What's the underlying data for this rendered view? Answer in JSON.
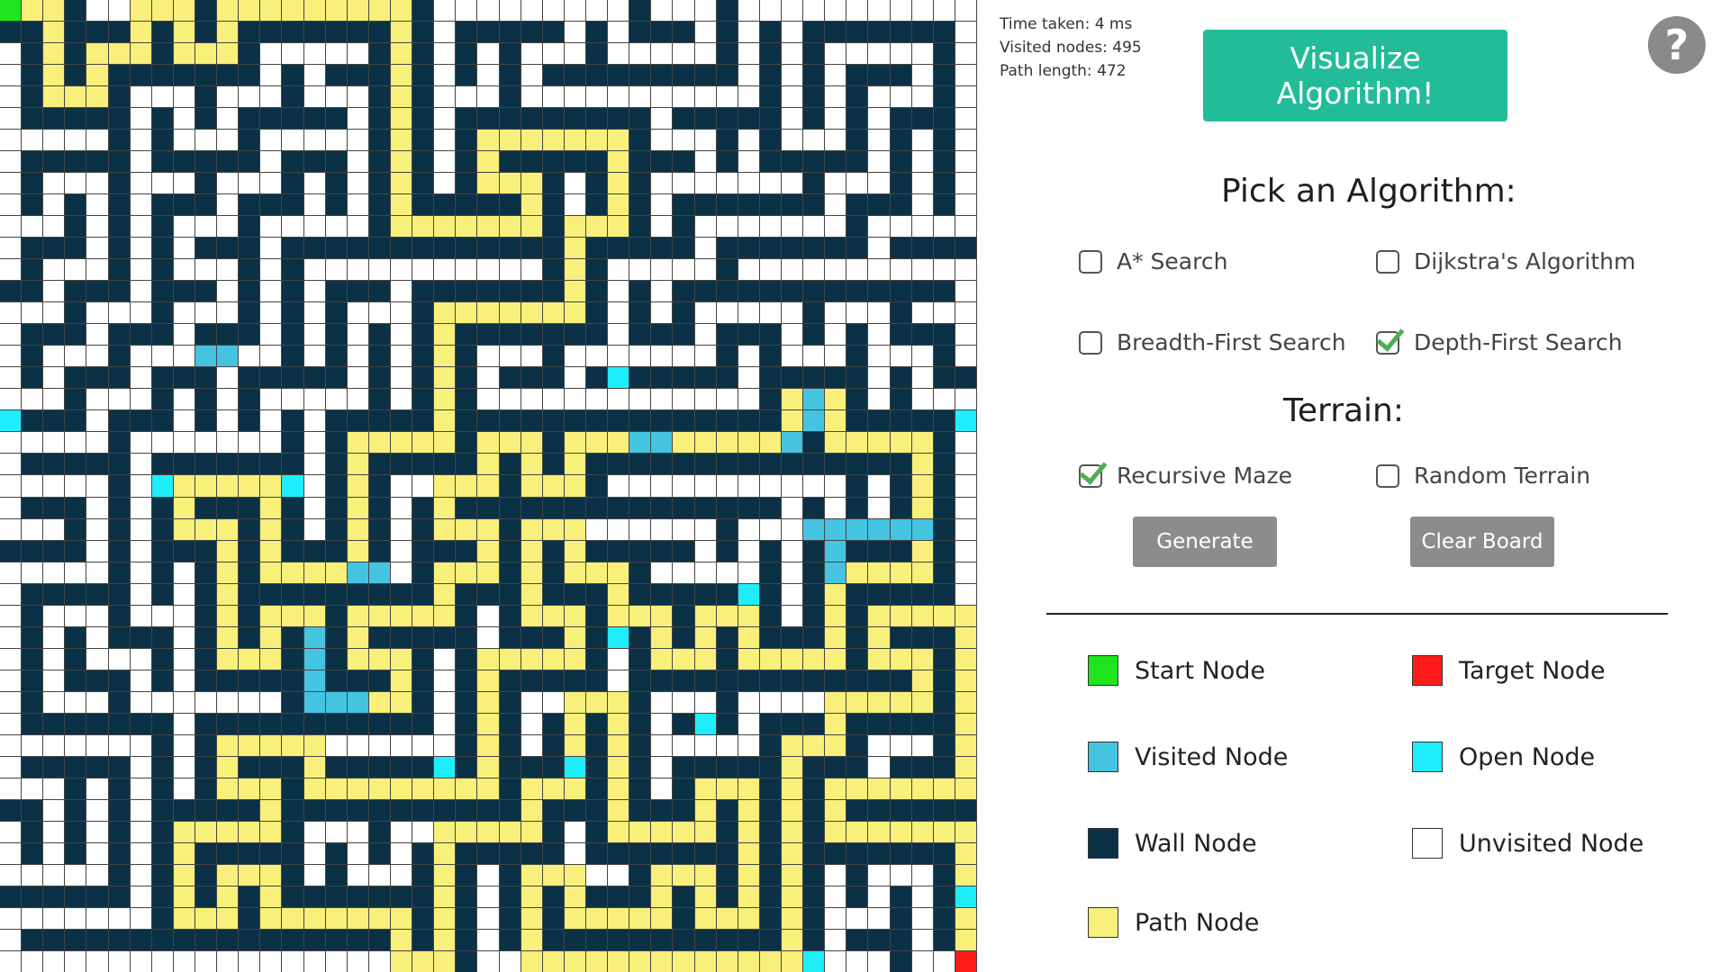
{
  "stats": {
    "time_taken": "Time taken: 4 ms",
    "visited_nodes": "Visited nodes: 495",
    "path_length": "Path length: 472"
  },
  "visualize_label": "Visualize Algorithm!",
  "help_label": "?",
  "algorithm_section": {
    "title": "Pick an Algorithm:",
    "options": [
      {
        "label": "A* Search",
        "checked": false
      },
      {
        "label": "Dijkstra's Algorithm",
        "checked": false
      },
      {
        "label": "Breadth-First Search",
        "checked": false
      },
      {
        "label": "Depth-First Search",
        "checked": true
      }
    ]
  },
  "terrain_section": {
    "title": "Terrain:",
    "options": [
      {
        "label": "Recursive Maze",
        "checked": true
      },
      {
        "label": "Random Terrain",
        "checked": false
      }
    ]
  },
  "buttons": {
    "generate": "Generate",
    "clear": "Clear Board"
  },
  "legend": [
    {
      "label": "Start Node",
      "color": "#1ee51e"
    },
    {
      "label": "Target Node",
      "color": "#ff1a1a"
    },
    {
      "label": "Visited Node",
      "color": "#45c4e2"
    },
    {
      "label": "Open Node",
      "color": "#1eeefb"
    },
    {
      "label": "Wall Node",
      "color": "#0b3146"
    },
    {
      "label": "Unvisited Node",
      "color": "#ffffff"
    },
    {
      "label": "Path Node",
      "color": "#f8f07a"
    }
  ],
  "grid": {
    "rows": 45,
    "cols": 45,
    "start": [
      0,
      0
    ],
    "target": [
      44,
      44
    ],
    "visited": [
      [
        16,
        9
      ],
      [
        16,
        10
      ],
      [
        18,
        37
      ],
      [
        19,
        37
      ],
      [
        20,
        29
      ],
      [
        20,
        30
      ],
      [
        20,
        36
      ],
      [
        24,
        37
      ],
      [
        24,
        38
      ],
      [
        24,
        39
      ],
      [
        24,
        40
      ],
      [
        24,
        41
      ],
      [
        24,
        42
      ],
      [
        25,
        38
      ],
      [
        26,
        38
      ],
      [
        26,
        16
      ],
      [
        26,
        17
      ],
      [
        29,
        14
      ],
      [
        30,
        14
      ],
      [
        31,
        14
      ],
      [
        32,
        14
      ],
      [
        32,
        15
      ],
      [
        32,
        16
      ]
    ],
    "open": [
      [
        19,
        0
      ],
      [
        19,
        44
      ],
      [
        22,
        7
      ],
      [
        22,
        13
      ],
      [
        17,
        28
      ],
      [
        27,
        34
      ],
      [
        29,
        28
      ],
      [
        33,
        32
      ],
      [
        35,
        20
      ],
      [
        35,
        26
      ],
      [
        41,
        44
      ],
      [
        44,
        37
      ]
    ]
  }
}
